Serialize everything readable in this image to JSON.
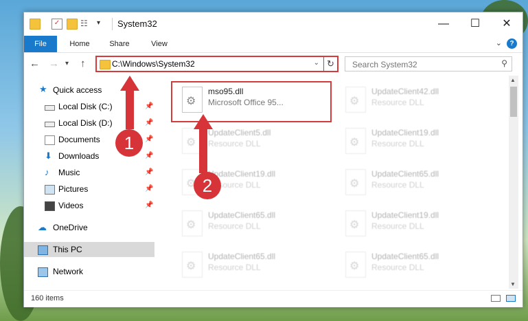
{
  "titlebar": {
    "title": "System32",
    "buttons": {
      "minimize": "—",
      "maximize": "☐",
      "close": "✕"
    }
  },
  "ribbon": {
    "tabs": [
      "File",
      "Home",
      "Share",
      "View"
    ],
    "help_label": "?"
  },
  "address": {
    "path": "C:\\Windows\\System32"
  },
  "search": {
    "placeholder": "Search System32"
  },
  "nav": {
    "items": [
      {
        "label": "Quick access",
        "icon": "star-icon"
      },
      {
        "label": "Local Disk (C:)",
        "icon": "drive-icon"
      },
      {
        "label": "Local Disk (D:)",
        "icon": "drive-icon"
      },
      {
        "label": "Documents",
        "icon": "documents-icon"
      },
      {
        "label": "Downloads",
        "icon": "download-icon"
      },
      {
        "label": "Music",
        "icon": "music-icon"
      },
      {
        "label": "Pictures",
        "icon": "pictures-icon"
      },
      {
        "label": "Videos",
        "icon": "videos-icon"
      },
      {
        "label": "OneDrive",
        "icon": "cloud-icon"
      },
      {
        "label": "This PC",
        "icon": "computer-icon"
      },
      {
        "label": "Network",
        "icon": "network-icon"
      }
    ]
  },
  "files": [
    {
      "name": "mso95.dll",
      "desc": "Microsoft Office 95..."
    },
    {
      "name": "UpdateClient42.dll",
      "desc": "Resource DLL"
    },
    {
      "name": "UpdateClient5.dll",
      "desc": "Resource DLL"
    },
    {
      "name": "UpdateClient19.dll",
      "desc": "Resource DLL"
    },
    {
      "name": "UpdateClient19.dll",
      "desc": "Resource DLL"
    },
    {
      "name": "UpdateClient65.dll",
      "desc": "Resource DLL"
    },
    {
      "name": "UpdateClient65.dll",
      "desc": "Resource DLL"
    },
    {
      "name": "UpdateClient19.dll",
      "desc": "Resource DLL"
    },
    {
      "name": "UpdateClient65.dll",
      "desc": "Resource DLL"
    },
    {
      "name": "UpdateClient65.dll",
      "desc": "Resource DLL"
    }
  ],
  "status": {
    "item_count": "160 items"
  },
  "annotations": {
    "step1": "1",
    "step2": "2"
  },
  "colors": {
    "accent": "#1979ca",
    "highlight": "#d63b3b",
    "folder": "#f5c33b"
  }
}
